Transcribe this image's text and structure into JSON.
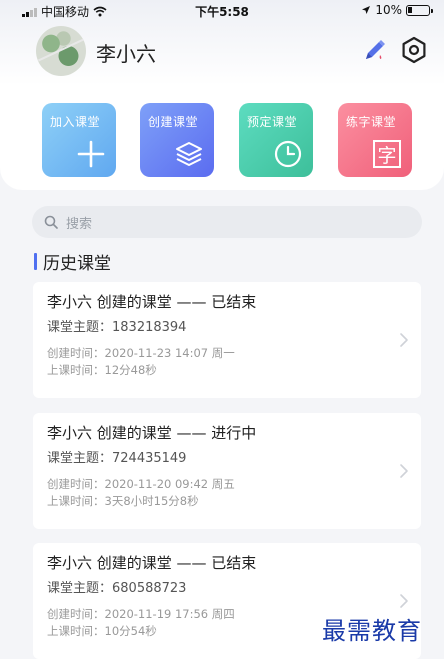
{
  "status_bar": {
    "carrier": "中国移动",
    "time": "下午5:58",
    "battery": "10%"
  },
  "profile": {
    "name": "李小六"
  },
  "actions": [
    {
      "label": "加入课堂",
      "icon": "plus-icon"
    },
    {
      "label": "创建课堂",
      "icon": "layers-icon"
    },
    {
      "label": "预定课堂",
      "icon": "clock-icon"
    },
    {
      "label": "练字课堂",
      "icon": "character-icon",
      "glyph": "字"
    }
  ],
  "search": {
    "placeholder": "搜索"
  },
  "history": {
    "title": "历史课堂",
    "items": [
      {
        "title": "李小六 创建的课堂 —— 已结束",
        "topic": "课堂主题：183218394",
        "created": "创建时间：2020-11-23 14:07 周一",
        "duration": "上课时间：12分48秒"
      },
      {
        "title": "李小六 创建的课堂 —— 进行中",
        "topic": "课堂主题：724435149",
        "created": "创建时间：2020-11-20 09:42 周五",
        "duration": "上课时间：3天8小时15分8秒"
      },
      {
        "title": "李小六 创建的课堂 —— 已结束",
        "topic": "课堂主题：680588723",
        "created": "创建时间：2020-11-19 17:56 周四",
        "duration": "上课时间：10分54秒"
      }
    ]
  },
  "watermark": "最需教育",
  "colors": {
    "accent": "#4f6ff0",
    "tile_join": "#60a8f0",
    "tile_create": "#5b6cf0",
    "tile_schedule": "#3dbf9a",
    "tile_practice": "#f0607a"
  }
}
